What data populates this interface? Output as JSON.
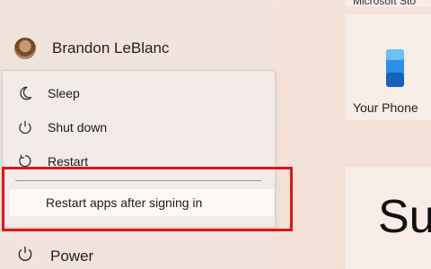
{
  "user": {
    "name": "Brandon LeBlanc"
  },
  "power_menu": {
    "items": [
      {
        "label": "Sleep",
        "icon": "moon-icon"
      },
      {
        "label": "Shut down",
        "icon": "power-icon"
      },
      {
        "label": "Restart",
        "icon": "restart-icon"
      }
    ],
    "submenu": {
      "label": "Restart apps after signing in"
    }
  },
  "power_button": {
    "label": "Power",
    "icon": "power-icon"
  },
  "tiles": {
    "top_label": "Microsoft Sto",
    "phone_label": "Your Phone",
    "big_text": "Su"
  },
  "colors": {
    "highlight": "#e1131b",
    "phone_icon": "#2b8fe6"
  }
}
